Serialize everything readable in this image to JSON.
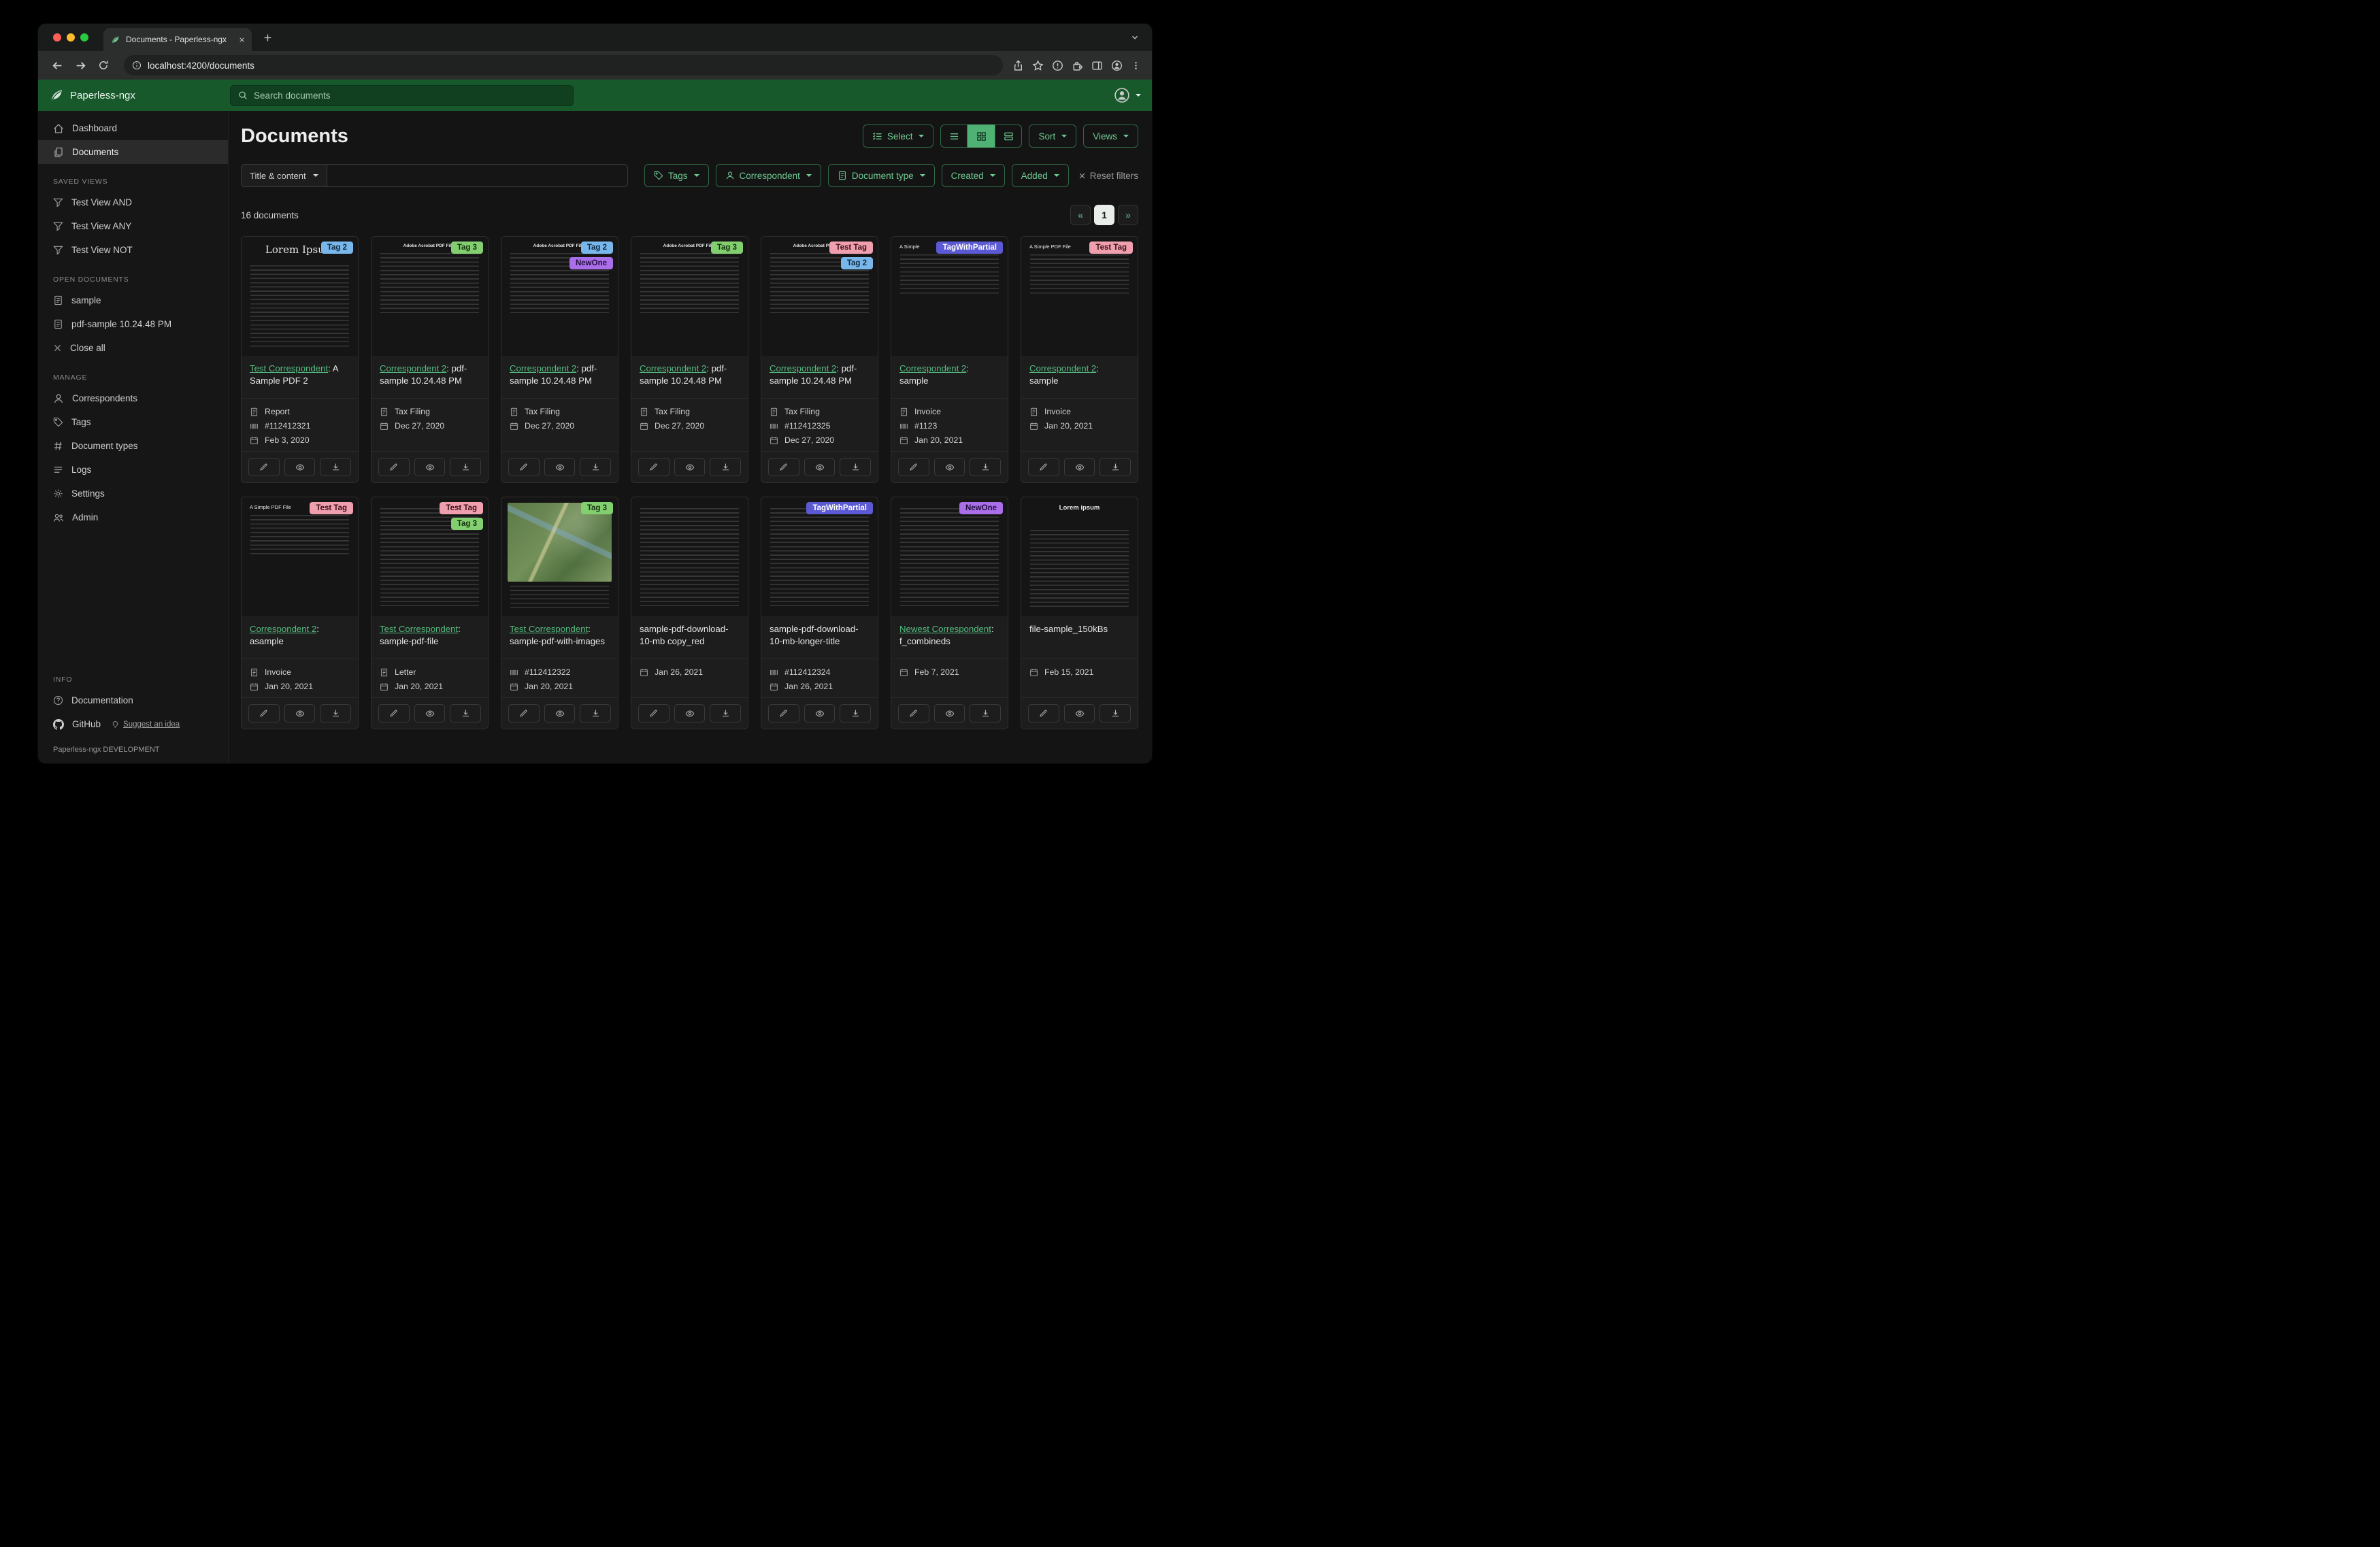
{
  "browser": {
    "tab_title": "Documents - Paperless-ngx",
    "url": "localhost:4200/documents"
  },
  "app_header": {
    "brand": "Paperless-ngx",
    "search_placeholder": "Search documents"
  },
  "sidebar": {
    "nav_dashboard": "Dashboard",
    "nav_documents": "Documents",
    "saved_views_title": "SAVED VIEWS",
    "saved_views": [
      "Test View AND",
      "Test View ANY",
      "Test View NOT"
    ],
    "open_documents_title": "OPEN DOCUMENTS",
    "open_documents": [
      "sample",
      "pdf-sample 10.24.48 PM"
    ],
    "close_all": "Close all",
    "manage_title": "MANAGE",
    "manage": [
      "Correspondents",
      "Tags",
      "Document types",
      "Logs",
      "Settings",
      "Admin"
    ],
    "info_title": "INFO",
    "documentation": "Documentation",
    "github": "GitHub",
    "suggest": "Suggest an idea",
    "footer": "Paperless-ngx DEVELOPMENT"
  },
  "page": {
    "title": "Documents",
    "select": "Select",
    "sort": "Sort",
    "views": "Views",
    "count": "16 documents"
  },
  "filters": {
    "title_content": "Title & content",
    "tags": "Tags",
    "correspondent": "Correspondent",
    "document_type": "Document type",
    "created": "Created",
    "added": "Added",
    "reset": "Reset filters"
  },
  "pagination": {
    "prev": "«",
    "current": "1",
    "next": "»"
  },
  "colors": {
    "accent_green": "#55bd80",
    "header_green": "#17592b"
  },
  "documents": [
    {
      "tags": [
        {
          "label": "Tag 2",
          "bg": "#79b6ea",
          "fg": "#0d2b44"
        }
      ],
      "title_link": "Test Correspondent",
      "title_rest": ": A Sample PDF 2",
      "doc_type": "Report",
      "asn": "#112412321",
      "date": "Feb 3, 2020",
      "thumb": {
        "variant": "serif",
        "heading": "Lorem Ipsum"
      }
    },
    {
      "tags": [
        {
          "label": "Tag 3",
          "bg": "#83cf70",
          "fg": "#14300d"
        }
      ],
      "title_link": "Correspondent 2",
      "title_rest": ": pdf-sample 10.24.48 PM",
      "doc_type": "Tax Filing",
      "asn": "",
      "date": "Dec 27, 2020",
      "thumb": {
        "variant": "small",
        "heading": "Adobe Acrobat PDF Files"
      }
    },
    {
      "tags": [
        {
          "label": "Tag 2",
          "bg": "#79b6ea",
          "fg": "#0d2b44"
        },
        {
          "label": "NewOne",
          "bg": "#a96ee8",
          "fg": "#230f3d"
        }
      ],
      "title_link": "Correspondent 2",
      "title_rest": ": pdf-sample 10.24.48 PM",
      "doc_type": "Tax Filing",
      "asn": "",
      "date": "Dec 27, 2020",
      "thumb": {
        "variant": "small",
        "heading": "Adobe Acrobat PDF Files"
      }
    },
    {
      "tags": [
        {
          "label": "Tag 3",
          "bg": "#83cf70",
          "fg": "#14300d"
        }
      ],
      "title_link": "Correspondent 2",
      "title_rest": ": pdf-sample 10.24.48 PM",
      "doc_type": "Tax Filing",
      "asn": "",
      "date": "Dec 27, 2020",
      "thumb": {
        "variant": "small",
        "heading": "Adobe Acrobat PDF Files"
      }
    },
    {
      "tags": [
        {
          "label": "Test Tag",
          "bg": "#ef9fae",
          "fg": "#3a0f18"
        },
        {
          "label": "Tag 2",
          "bg": "#79b6ea",
          "fg": "#0d2b44"
        }
      ],
      "title_link": "Correspondent 2",
      "title_rest": ": pdf-sample 10.24.48 PM",
      "doc_type": "Tax Filing",
      "asn": "#112412325",
      "date": "Dec 27, 2020",
      "thumb": {
        "variant": "small",
        "heading": "Adobe Acrobat PDF Files"
      }
    },
    {
      "tags": [
        {
          "label": "TagWithPartial",
          "bg": "#5b5ad4",
          "fg": "#ffffff"
        }
      ],
      "title_link": "Correspondent 2",
      "title_rest": ": sample",
      "doc_type": "Invoice",
      "asn": "#1123",
      "date": "Jan 20, 2021",
      "thumb": {
        "variant": "smallleft",
        "heading": "A Simple"
      }
    },
    {
      "tags": [
        {
          "label": "Test Tag",
          "bg": "#ef9fae",
          "fg": "#3a0f18"
        }
      ],
      "title_link": "Correspondent 2",
      "title_rest": ": sample",
      "doc_type": "Invoice",
      "asn": "",
      "date": "Jan 20, 2021",
      "thumb": {
        "variant": "smallleft",
        "heading": "A Simple PDF File"
      }
    },
    {
      "tags": [
        {
          "label": "Test Tag",
          "bg": "#ef9fae",
          "fg": "#3a0f18"
        }
      ],
      "title_link": "Correspondent 2",
      "title_rest": ": asample",
      "doc_type": "Invoice",
      "asn": "",
      "date": "Jan 20, 2021",
      "thumb": {
        "variant": "smallleft",
        "heading": "A Simple PDF File"
      }
    },
    {
      "tags": [
        {
          "label": "Test Tag",
          "bg": "#ef9fae",
          "fg": "#3a0f18"
        },
        {
          "label": "Tag 3",
          "bg": "#83cf70",
          "fg": "#14300d"
        }
      ],
      "title_link": "Test Correspondent",
      "title_rest": ": sample-pdf-file",
      "doc_type": "Letter",
      "asn": "",
      "date": "Jan 20, 2021",
      "thumb": {
        "variant": "body",
        "heading": ""
      }
    },
    {
      "tags": [
        {
          "label": "Tag 3",
          "bg": "#83cf70",
          "fg": "#14300d"
        }
      ],
      "title_link": "Test Correspondent",
      "title_rest": ": sample-pdf-with-images",
      "doc_type": "",
      "asn": "#112412322",
      "date": "Jan 20, 2021",
      "thumb": {
        "variant": "map",
        "heading": ""
      }
    },
    {
      "tags": [],
      "title_link": "",
      "title_rest": "sample-pdf-download-10-mb copy_red",
      "doc_type": "",
      "asn": "",
      "date": "Jan 26, 2021",
      "thumb": {
        "variant": "body",
        "heading": ""
      }
    },
    {
      "tags": [
        {
          "label": "TagWithPartial",
          "bg": "#5b5ad4",
          "fg": "#ffffff"
        }
      ],
      "title_link": "",
      "title_rest": "sample-pdf-download-10-mb-longer-title",
      "doc_type": "",
      "asn": "#112412324",
      "date": "Jan 26, 2021",
      "thumb": {
        "variant": "body",
        "heading": ""
      }
    },
    {
      "tags": [
        {
          "label": "NewOne",
          "bg": "#a96ee8",
          "fg": "#230f3d"
        }
      ],
      "title_link": "Newest Correspondent",
      "title_rest": ": f_combineds",
      "doc_type": "",
      "asn": "",
      "date": "Feb 7, 2021",
      "thumb": {
        "variant": "body",
        "heading": ""
      }
    },
    {
      "tags": [],
      "title_link": "",
      "title_rest": "file-sample_150kBs",
      "doc_type": "",
      "asn": "",
      "date": "Feb 15, 2021",
      "thumb": {
        "variant": "lorem",
        "heading": "Lorem ipsum"
      }
    }
  ]
}
